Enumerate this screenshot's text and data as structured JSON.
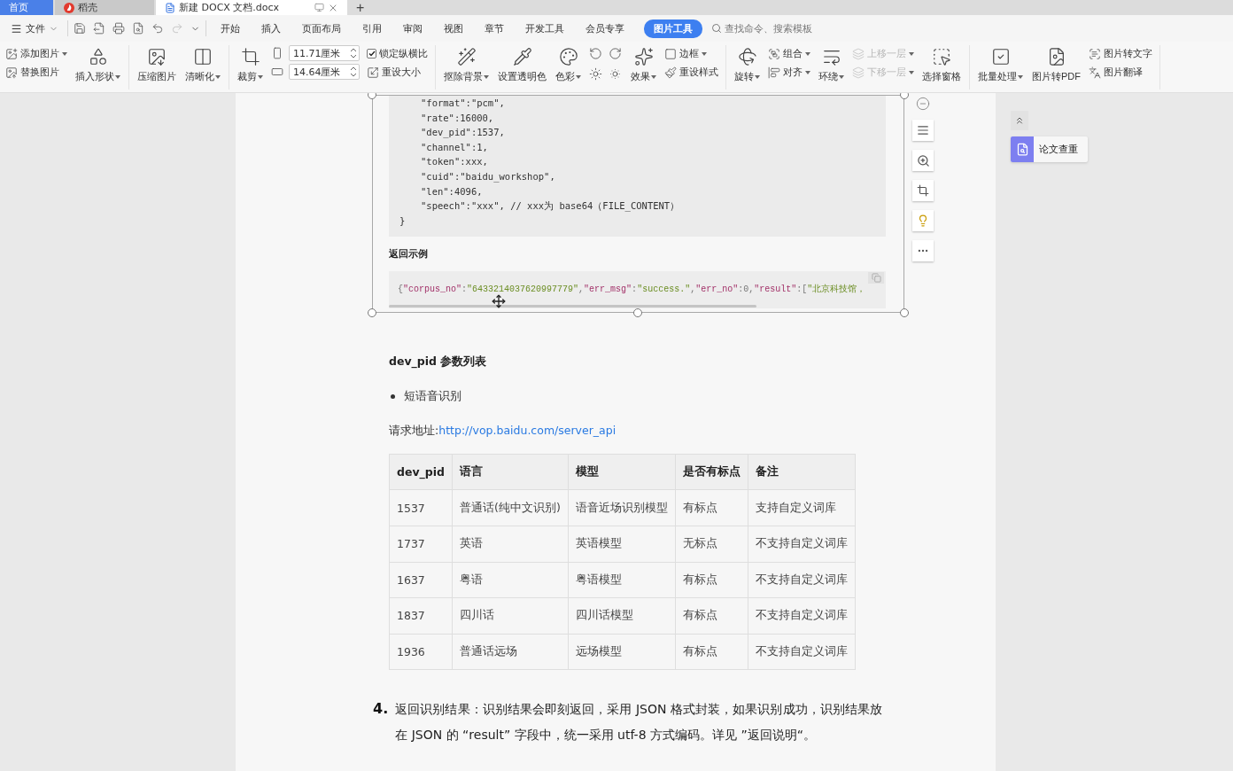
{
  "tabs": [
    {
      "label": "首页",
      "kind": "home",
      "selected": false
    },
    {
      "label": "稻壳",
      "kind": "docer",
      "selected": false
    },
    {
      "label": "新建 DOCX 文档.docx",
      "kind": "doc",
      "selected": true
    }
  ],
  "new_tab": "+",
  "file_menu": "文件",
  "menu": [
    {
      "label": "开始",
      "selected": false
    },
    {
      "label": "插入",
      "selected": false
    },
    {
      "label": "页面布局",
      "selected": false
    },
    {
      "label": "引用",
      "selected": false
    },
    {
      "label": "审阅",
      "selected": false
    },
    {
      "label": "视图",
      "selected": false
    },
    {
      "label": "章节",
      "selected": false
    },
    {
      "label": "开发工具",
      "selected": false
    },
    {
      "label": "会员专享",
      "selected": false
    },
    {
      "label": "图片工具",
      "selected": true
    }
  ],
  "search": {
    "placeholder": "查找命令、搜索模板"
  },
  "ribbon": [
    {
      "columns": [
        {
          "kind": "stack",
          "items": [
            {
              "kind": "button",
              "label": "添加图片",
              "dropdown": true,
              "disabled": false
            },
            {
              "kind": "button",
              "label": "替换图片",
              "dropdown": false,
              "disabled": false
            }
          ]
        },
        {
          "kind": "large",
          "label": "插入形状",
          "dropdown": true
        }
      ]
    },
    {
      "columns": [
        {
          "kind": "large",
          "label": "压缩图片",
          "dropdown": false
        },
        {
          "kind": "large",
          "label": "清晰化",
          "dropdown": true
        }
      ]
    },
    {
      "columns": [
        {
          "kind": "large",
          "label": "裁剪",
          "dropdown": true
        },
        {
          "kind": "size",
          "fields": [
            {
              "value": "11.71厘米"
            },
            {
              "value": "14.64厘米"
            }
          ]
        },
        {
          "kind": "stack",
          "items": [
            {
              "kind": "check",
              "label": "锁定纵横比",
              "checked": true
            },
            {
              "kind": "button",
              "label": "重设大小",
              "dropdown": false,
              "disabled": false
            }
          ]
        }
      ]
    },
    {
      "columns": [
        {
          "kind": "large",
          "label": "抠除背景",
          "dropdown": true
        },
        {
          "kind": "large",
          "label": "设置透明色",
          "dropdown": false
        },
        {
          "kind": "large",
          "label": "色彩",
          "dropdown": true
        },
        {
          "kind": "icon_grid"
        },
        {
          "kind": "large",
          "label": "效果",
          "dropdown": true
        },
        {
          "kind": "stack",
          "items": [
            {
              "kind": "button",
              "label": "边框",
              "dropdown": true,
              "disabled": false
            },
            {
              "kind": "button",
              "label": "重设样式",
              "dropdown": false,
              "disabled": false
            }
          ]
        }
      ]
    },
    {
      "columns": [
        {
          "kind": "large",
          "label": "旋转",
          "dropdown": true
        },
        {
          "kind": "stack",
          "items": [
            {
              "kind": "button",
              "label": "组合",
              "dropdown": true,
              "disabled": false
            },
            {
              "kind": "button",
              "label": "对齐",
              "dropdown": true,
              "disabled": false
            }
          ]
        },
        {
          "kind": "large",
          "label": "环绕",
          "dropdown": true
        },
        {
          "kind": "stack",
          "items": [
            {
              "kind": "button",
              "label": "上移一层",
              "dropdown": true,
              "disabled": true
            },
            {
              "kind": "button",
              "label": "下移一层",
              "dropdown": true,
              "disabled": true
            }
          ]
        },
        {
          "kind": "large",
          "label": "选择窗格",
          "dropdown": false
        }
      ]
    },
    {
      "columns": [
        {
          "kind": "large",
          "label": "批量处理",
          "dropdown": true
        },
        {
          "kind": "large",
          "label": "图片转PDF",
          "dropdown": false
        },
        {
          "kind": "stack",
          "items": [
            {
              "kind": "button",
              "label": "图片转文字",
              "dropdown": false,
              "disabled": false
            },
            {
              "kind": "button",
              "label": "图片翻译",
              "dropdown": false,
              "disabled": false
            }
          ]
        }
      ]
    }
  ],
  "image": {
    "code_lines": [
      "\"format\":\"pcm\",",
      "\"rate\":16000,",
      "\"dev_pid\":1537,",
      "\"channel\":1,",
      "\"token\":xxx,",
      "\"cuid\":\"baidu_workshop\",",
      "\"len\":4096,",
      "\"speech\":\"xxx\", // xxx为 base64（FILE_CONTENT）"
    ],
    "code_end": "}",
    "example_title": "返回示例",
    "example_tokens": [
      {
        "text": "{",
        "kind": "punct"
      },
      {
        "text": "\"corpus_no\"",
        "kind": "key"
      },
      {
        "text": ":",
        "kind": "punct"
      },
      {
        "text": "\"6433214037620997779\"",
        "kind": "string"
      },
      {
        "text": ",",
        "kind": "punct"
      },
      {
        "text": "\"err_msg\"",
        "kind": "key"
      },
      {
        "text": ":",
        "kind": "punct"
      },
      {
        "text": "\"success.\"",
        "kind": "string"
      },
      {
        "text": ",",
        "kind": "punct"
      },
      {
        "text": "\"err_no\"",
        "kind": "key"
      },
      {
        "text": ":0,",
        "kind": "punct"
      },
      {
        "text": "\"result\"",
        "kind": "key"
      },
      {
        "text": ":[",
        "kind": "punct"
      },
      {
        "text": "\"北京科技馆，",
        "kind": "string"
      }
    ]
  },
  "heading": "dev_pid 参数列表",
  "bullets": [
    "短语音识别"
  ],
  "request": {
    "label": "请求地址: ",
    "link": "http://vop.baidu.com/server_api"
  },
  "table": {
    "columns": [
      "dev_pid",
      "语言",
      "模型",
      "是否有标点",
      "备注"
    ],
    "rows": [
      [
        "1537",
        "普通话(纯中文识别)",
        "语音近场识别模型",
        "有标点",
        "支持自定义词库"
      ],
      [
        "1737",
        "英语",
        "英语模型",
        "无标点",
        "不支持自定义词库"
      ],
      [
        "1637",
        "粤语",
        "粤语模型",
        "有标点",
        "不支持自定义词库"
      ],
      [
        "1837",
        "四川话",
        "四川话模型",
        "有标点",
        "不支持自定义词库"
      ],
      [
        "1936",
        "普通话远场",
        "远场模型",
        "有标点",
        "不支持自定义词库"
      ]
    ]
  },
  "step": {
    "number": "4.",
    "text": "返回识别结果：识别结果会即刻返回，采用 JSON 格式封装，如果识别成功，识别结果放在 JSON 的 “result” 字段中，统一采用 utf-8 方式编码。详见 ”返回说明“。"
  },
  "side_panel": {
    "item": "论文查重"
  }
}
